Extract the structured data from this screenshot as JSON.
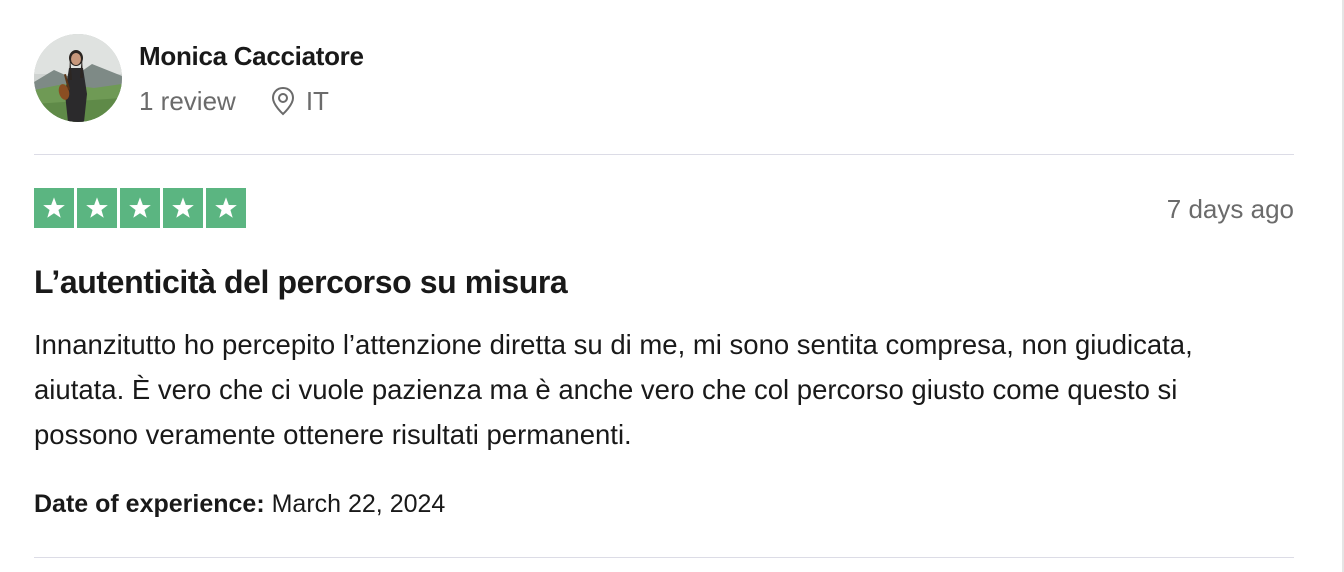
{
  "consumer": {
    "name": "Monica Cacciatore",
    "review_count": "1 review",
    "country": "IT",
    "location_icon": "location-pin-icon",
    "avatar": "profile-photo"
  },
  "review": {
    "rating": 5,
    "rating_max": 5,
    "star_color": "#5bb581",
    "date": "7 days ago",
    "title": "L’autenticità del percorso su misura",
    "body": "Innanzitutto ho percepito l’attenzione diretta su di me, mi sono sentita compresa, non giudicata, aiutata. È vero che ci vuole pazienza ma è anche vero che col percorso giusto come questo si possono veramente ottenere risultati permanenti.",
    "experience_label": "Date of experience:",
    "experience_date": "March 22, 2024"
  }
}
